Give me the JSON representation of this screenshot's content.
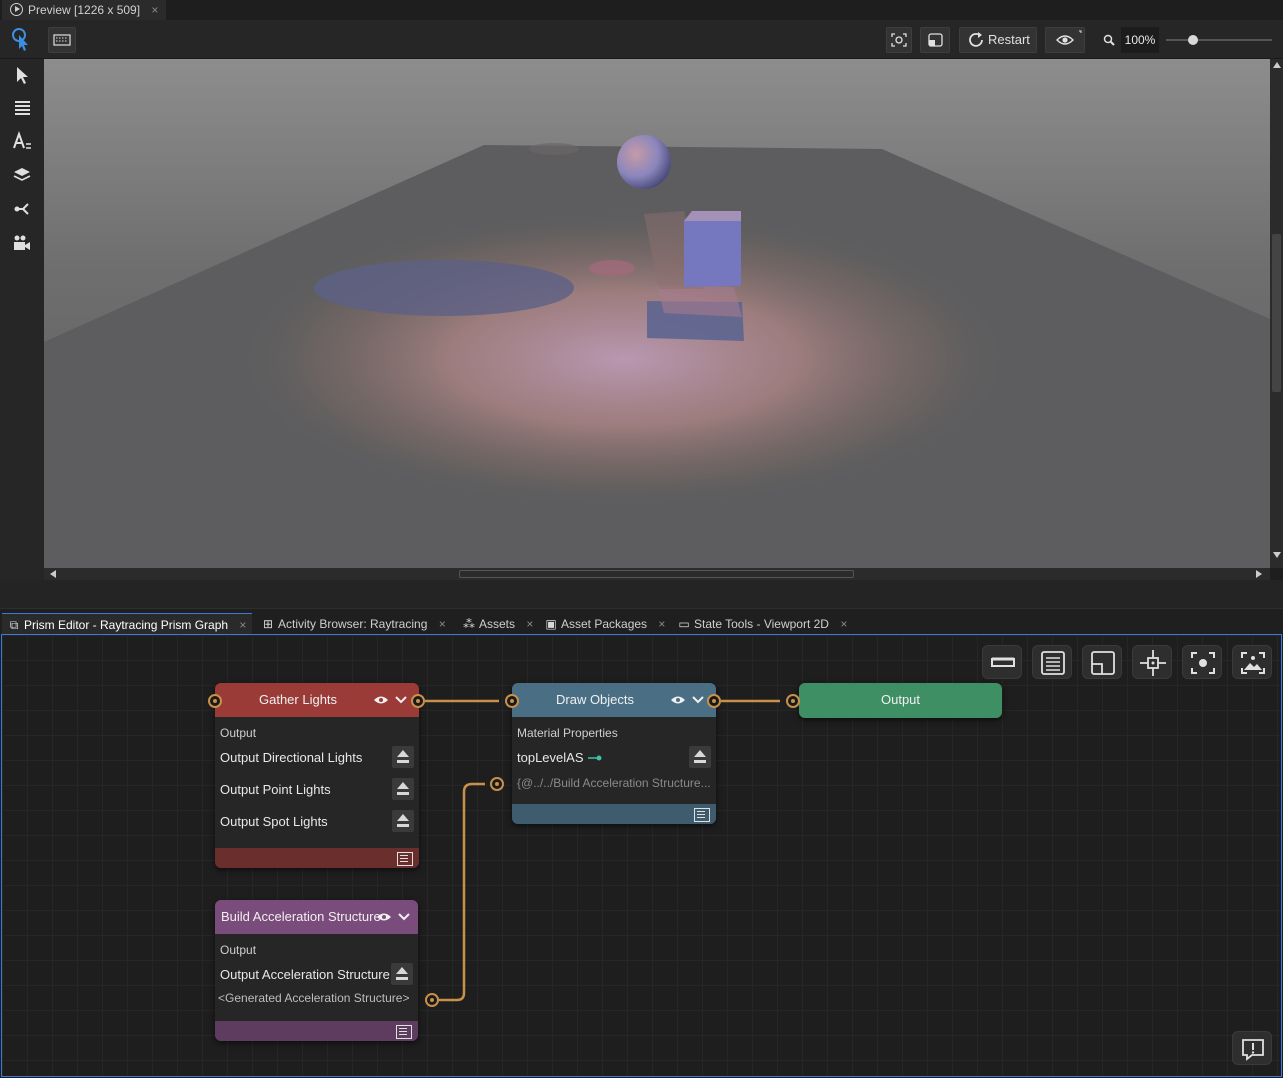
{
  "preview_tab": {
    "title": "Preview [1226 x 509]",
    "close": "×"
  },
  "toolbar": {
    "restart_label": "Restart",
    "zoom_value": "100%",
    "zoom_slider_fraction": 0.25
  },
  "left_rail": {
    "items": [
      "pointer-hand-icon",
      "select-arrow-icon",
      "grid-icon",
      "text-style-icon",
      "layers-icon",
      "connect-icon",
      "camera-icon"
    ]
  },
  "bottom_tabs": [
    {
      "label": "Prism Editor - Raytracing Prism Graph",
      "icon": "prism-editor-icon",
      "active": true
    },
    {
      "label": "Activity Browser: Raytracing",
      "icon": "activity-icon",
      "active": false
    },
    {
      "label": "Assets",
      "icon": "assets-icon",
      "active": false
    },
    {
      "label": "Asset Packages",
      "icon": "packages-icon",
      "active": false
    },
    {
      "label": "State Tools - Viewport 2D",
      "icon": "monitor-icon",
      "active": false
    }
  ],
  "graph": {
    "nodes": {
      "gather_lights": {
        "title": "Gather Lights",
        "section": "Output",
        "rows": [
          "Output Directional Lights",
          "Output Point Lights",
          "Output Spot Lights"
        ],
        "color": "#9a3b38"
      },
      "draw_objects": {
        "title": "Draw Objects",
        "section": "Material Properties",
        "property": "topLevelAS",
        "link_value": "{@../../Build Acceleration Structure...",
        "color": "#4a6f85"
      },
      "output": {
        "title": "Output",
        "color": "#3e8f64"
      },
      "build_as": {
        "title": "Build Acceleration Structure",
        "section": "Output",
        "row": "Output Acceleration Structure",
        "generated": "<Generated Acceleration Structure>",
        "color": "#7a4c7c"
      }
    },
    "connection_color": "#c8904a"
  }
}
